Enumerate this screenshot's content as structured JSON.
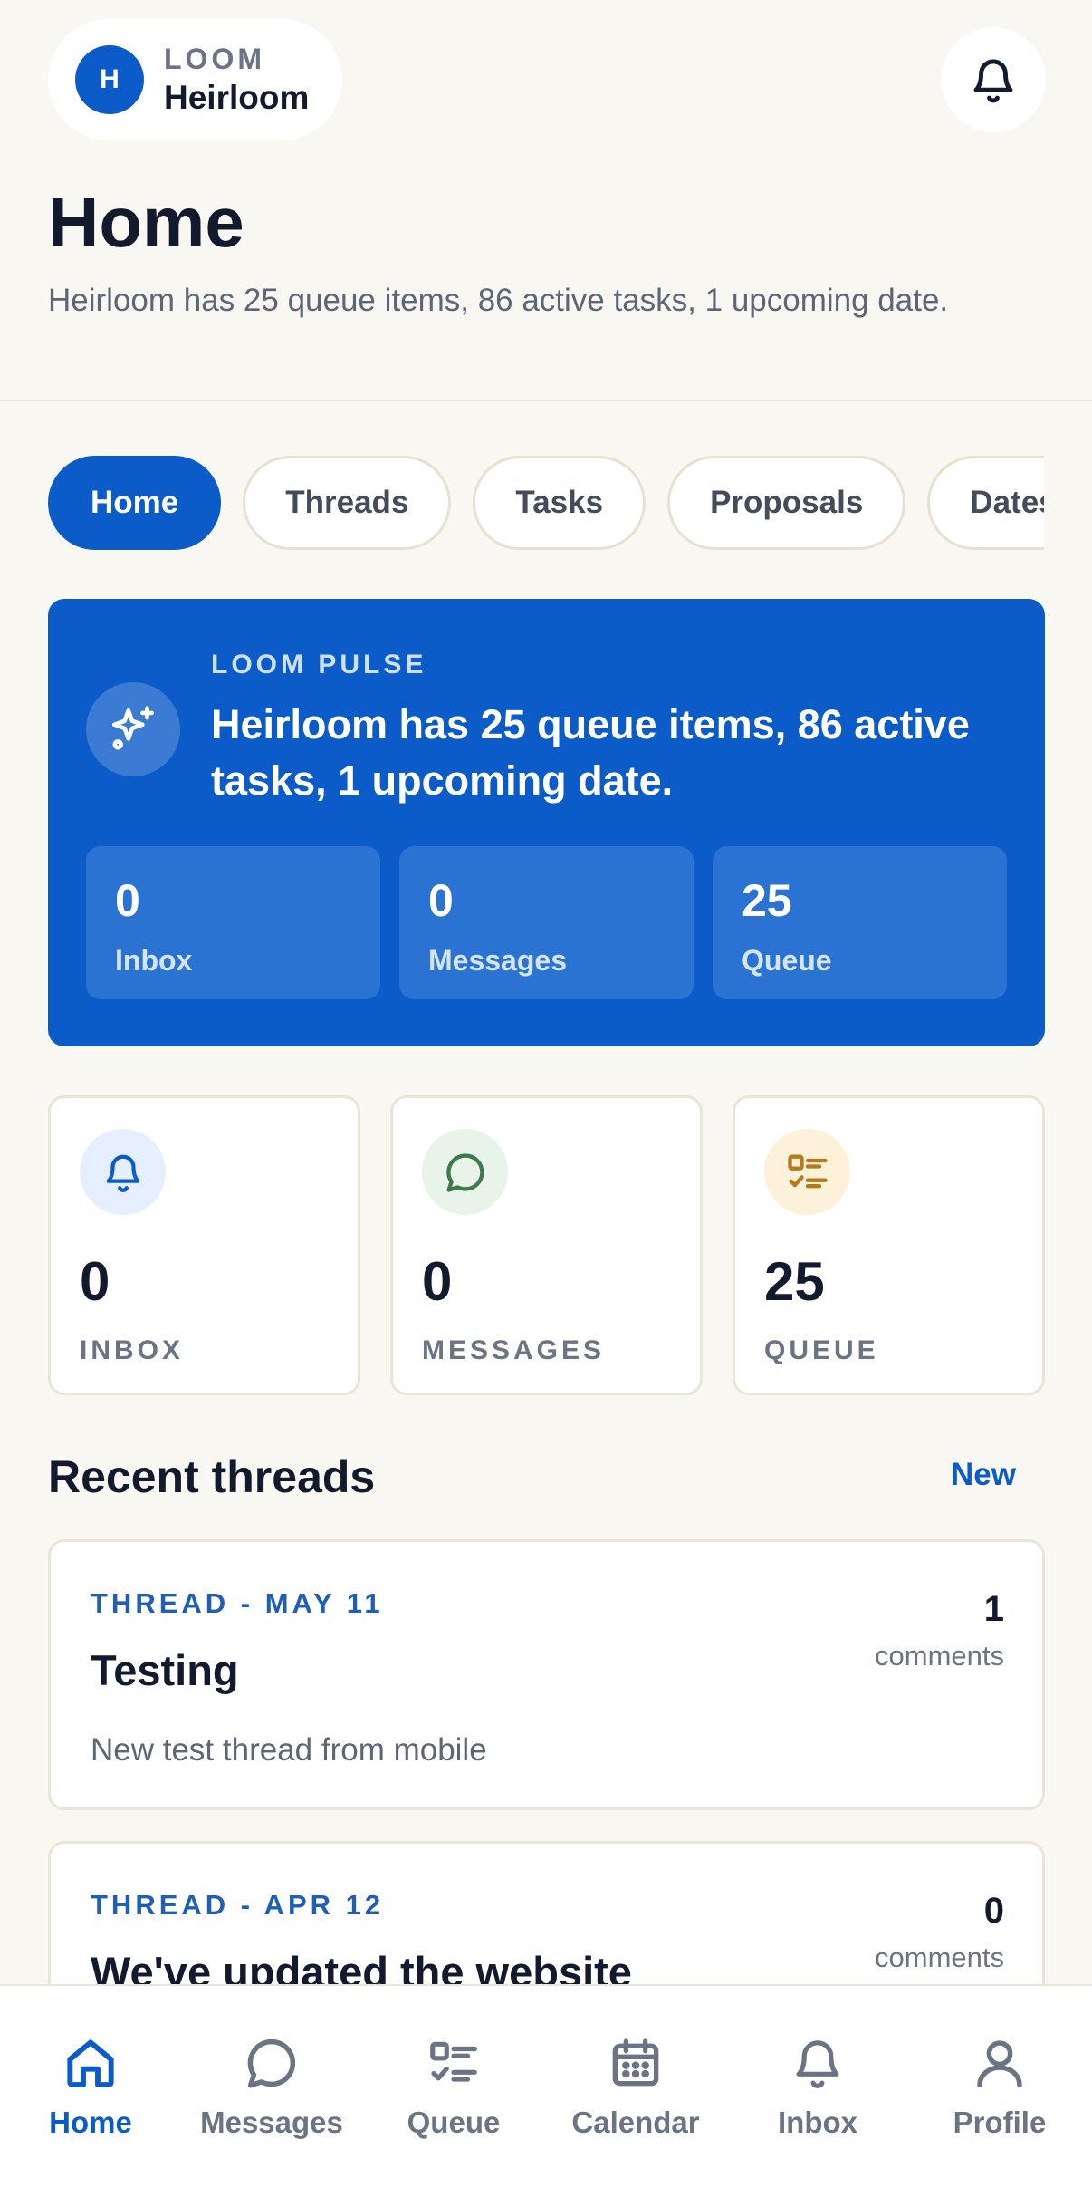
{
  "account": {
    "avatar_letter": "H",
    "brand": "LOOM",
    "name": "Heirloom"
  },
  "header": {
    "title": "Home",
    "subtitle": "Heirloom has 25 queue items, 86 active tasks, 1 upcoming date."
  },
  "tabs": [
    "Home",
    "Threads",
    "Tasks",
    "Proposals",
    "Dates"
  ],
  "pulse": {
    "eyebrow": "LOOM PULSE",
    "headline": "Heirloom has 25 queue items, 86 active tasks, 1 upcoming date.",
    "stats": [
      {
        "value": "0",
        "label": "Inbox"
      },
      {
        "value": "0",
        "label": "Messages"
      },
      {
        "value": "25",
        "label": "Queue"
      }
    ]
  },
  "metrics": [
    {
      "value": "0",
      "label": "INBOX",
      "icon": "bell-icon",
      "tint": "#e5efff",
      "color": "#0b5bc9"
    },
    {
      "value": "0",
      "label": "MESSAGES",
      "icon": "chat-bubble-icon",
      "tint": "#e8f3ea",
      "color": "#3e7a4a"
    },
    {
      "value": "25",
      "label": "QUEUE",
      "icon": "checklist-icon",
      "tint": "#fdf1d9",
      "color": "#b47a1c"
    }
  ],
  "recent_threads": {
    "title": "Recent threads",
    "action": "New",
    "items": [
      {
        "meta": "THREAD - MAY 11",
        "title": "Testing",
        "snippet": "New test thread from mobile",
        "count": "1",
        "count_label": "comments"
      },
      {
        "meta": "THREAD - APR 12",
        "title": "We've updated the website",
        "snippet": "",
        "count": "0",
        "count_label": "comments"
      }
    ]
  },
  "bottom_nav": [
    {
      "label": "Home",
      "icon": "home-icon",
      "active": true
    },
    {
      "label": "Messages",
      "icon": "chat-bubble-icon",
      "active": false
    },
    {
      "label": "Queue",
      "icon": "checklist-icon",
      "active": false
    },
    {
      "label": "Calendar",
      "icon": "calendar-icon",
      "active": false
    },
    {
      "label": "Inbox",
      "icon": "bell-icon",
      "active": false
    },
    {
      "label": "Profile",
      "icon": "person-icon",
      "active": false
    }
  ],
  "colors": {
    "primary": "#0b5bc9",
    "background": "#f9f7f2",
    "card_border": "#ebe5d6"
  }
}
